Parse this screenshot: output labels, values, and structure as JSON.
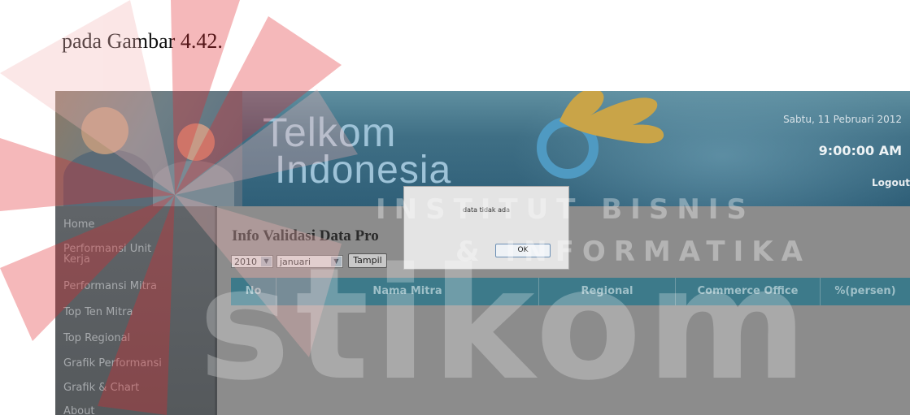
{
  "caption": "pada Gambar 4.42.",
  "header": {
    "logo_line1": "Telkom",
    "logo_line2": "Indonesia",
    "date": "Sabtu, 11 Pebruari 2012",
    "time": "9:00:00 AM",
    "logout_label": "Logout"
  },
  "sidebar": {
    "items": [
      {
        "label": "Home"
      },
      {
        "label": "Performansi Unit\nKerja"
      },
      {
        "label": "Performansi Mitra"
      },
      {
        "label": "Top Ten Mitra"
      },
      {
        "label": "Top Regional"
      },
      {
        "label": "Grafik Performansi"
      },
      {
        "label": "Grafik & Chart"
      },
      {
        "label": "About"
      }
    ]
  },
  "main": {
    "heading": "Info Validasi Data Pro",
    "year_select": "2010",
    "month_select": "januari",
    "show_button": "Tampil",
    "table_headers": [
      "No",
      "Nama Mitra",
      "Regional",
      "Commerce Office",
      "%(persen)"
    ]
  },
  "dialog": {
    "message": "data tidak ada",
    "ok_label": "OK"
  },
  "watermark": {
    "line1": "INSTITUT BISNIS",
    "line2": "& INFORMATIKA",
    "logo": "stikom"
  },
  "colors": {
    "watermark_red": "#e3262b",
    "table_header": "#3d7a8a",
    "sidebar": "#5b5f62"
  }
}
